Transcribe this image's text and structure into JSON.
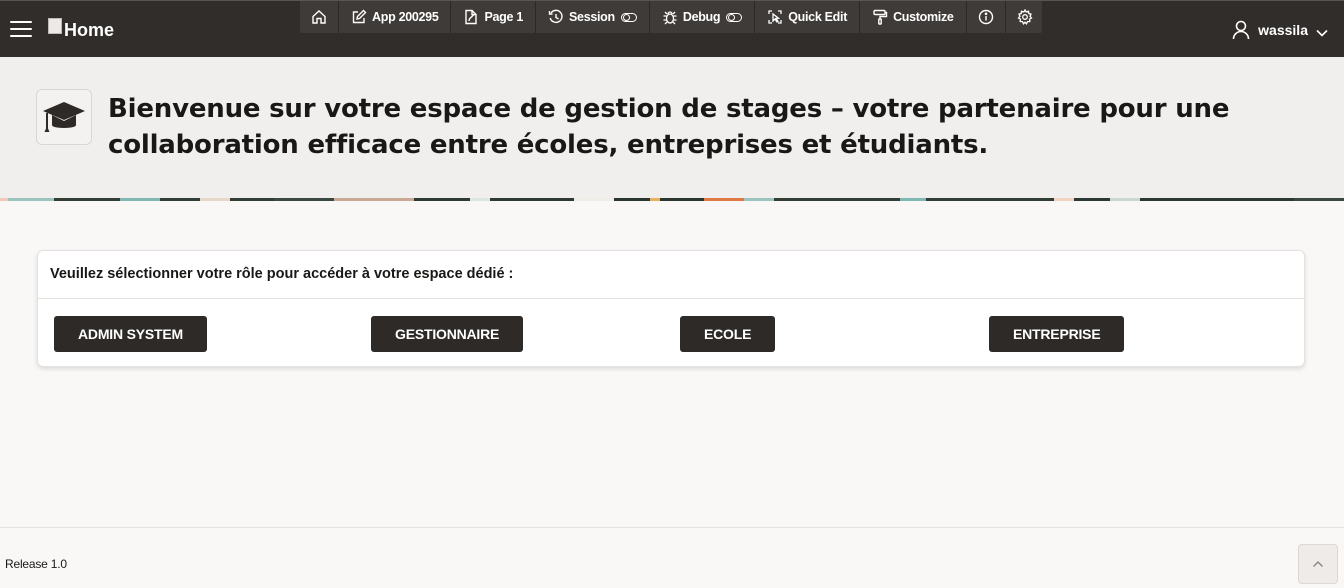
{
  "header": {
    "logo_alt": "Home",
    "user_name": "wassila"
  },
  "devbar": {
    "home_label": "",
    "app_label": "App 200295",
    "page_label": "Page 1",
    "session_label": "Session",
    "debug_label": "Debug",
    "quick_edit_label": "Quick Edit",
    "customize_label": "Customize"
  },
  "hero": {
    "title": "Bienvenue sur votre espace de gestion de stages – votre partenaire pour une collaboration efficace entre écoles, entreprises et étudiants."
  },
  "roles": {
    "prompt": "Veuillez sélectionner votre rôle pour accéder à votre espace dédié :",
    "admin_label": "ADMIN SYSTEM",
    "gestionnaire_label": "GESTIONNAIRE",
    "ecole_label": "ECOLE",
    "entreprise_label": "ENTREPRISE"
  },
  "footer": {
    "release": "Release 1.0"
  },
  "colors": {
    "header_bg": "#312d2a",
    "devbar_bg": "#3f3b38",
    "button_bg": "#2e2a27",
    "page_bg": "#f9f8f7",
    "hero_bg": "#f1efed"
  }
}
